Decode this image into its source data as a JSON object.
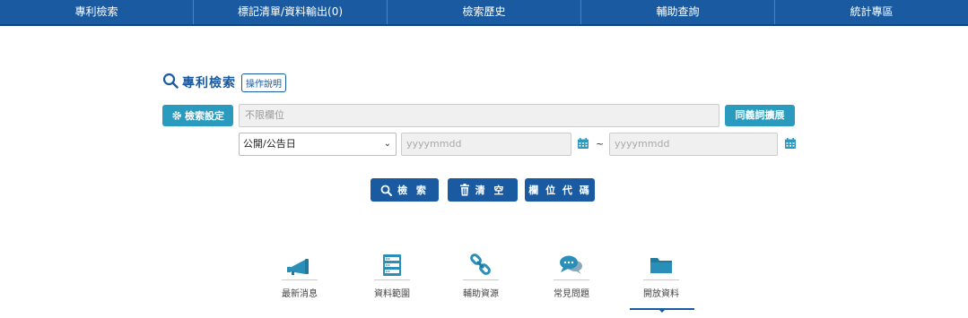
{
  "nav": {
    "items": [
      {
        "label": "專利檢索"
      },
      {
        "label": "標記清單/資料輸出(0)"
      },
      {
        "label": "檢索歷史"
      },
      {
        "label": "輔助查詢"
      },
      {
        "label": "統計專區"
      }
    ]
  },
  "search": {
    "title": "專利檢索",
    "help_label": "操作說明",
    "settings_label": "檢索設定",
    "main_placeholder": "不限欄位",
    "synonym_label": "同義詞擴展",
    "date_field": "公開/公告日",
    "date_from_placeholder": "yyyymmdd",
    "date_to_placeholder": "yyyymmdd",
    "date_separator": "~"
  },
  "actions": {
    "search_label": "檢 索",
    "clear_label": "清 空",
    "field_code_label": "欄 位 代 碼"
  },
  "features": [
    {
      "label": "最新消息",
      "icon": "megaphone-icon"
    },
    {
      "label": "資料範圍",
      "icon": "server-icon"
    },
    {
      "label": "輔助資源",
      "icon": "link-icon"
    },
    {
      "label": "常見問題",
      "icon": "chat-icon"
    },
    {
      "label": "開放資料",
      "icon": "folder-icon"
    }
  ],
  "colors": {
    "nav_bg": "#1a5aa0",
    "accent_teal": "#2a9bbf",
    "icon_teal": "#2a8fb8"
  }
}
